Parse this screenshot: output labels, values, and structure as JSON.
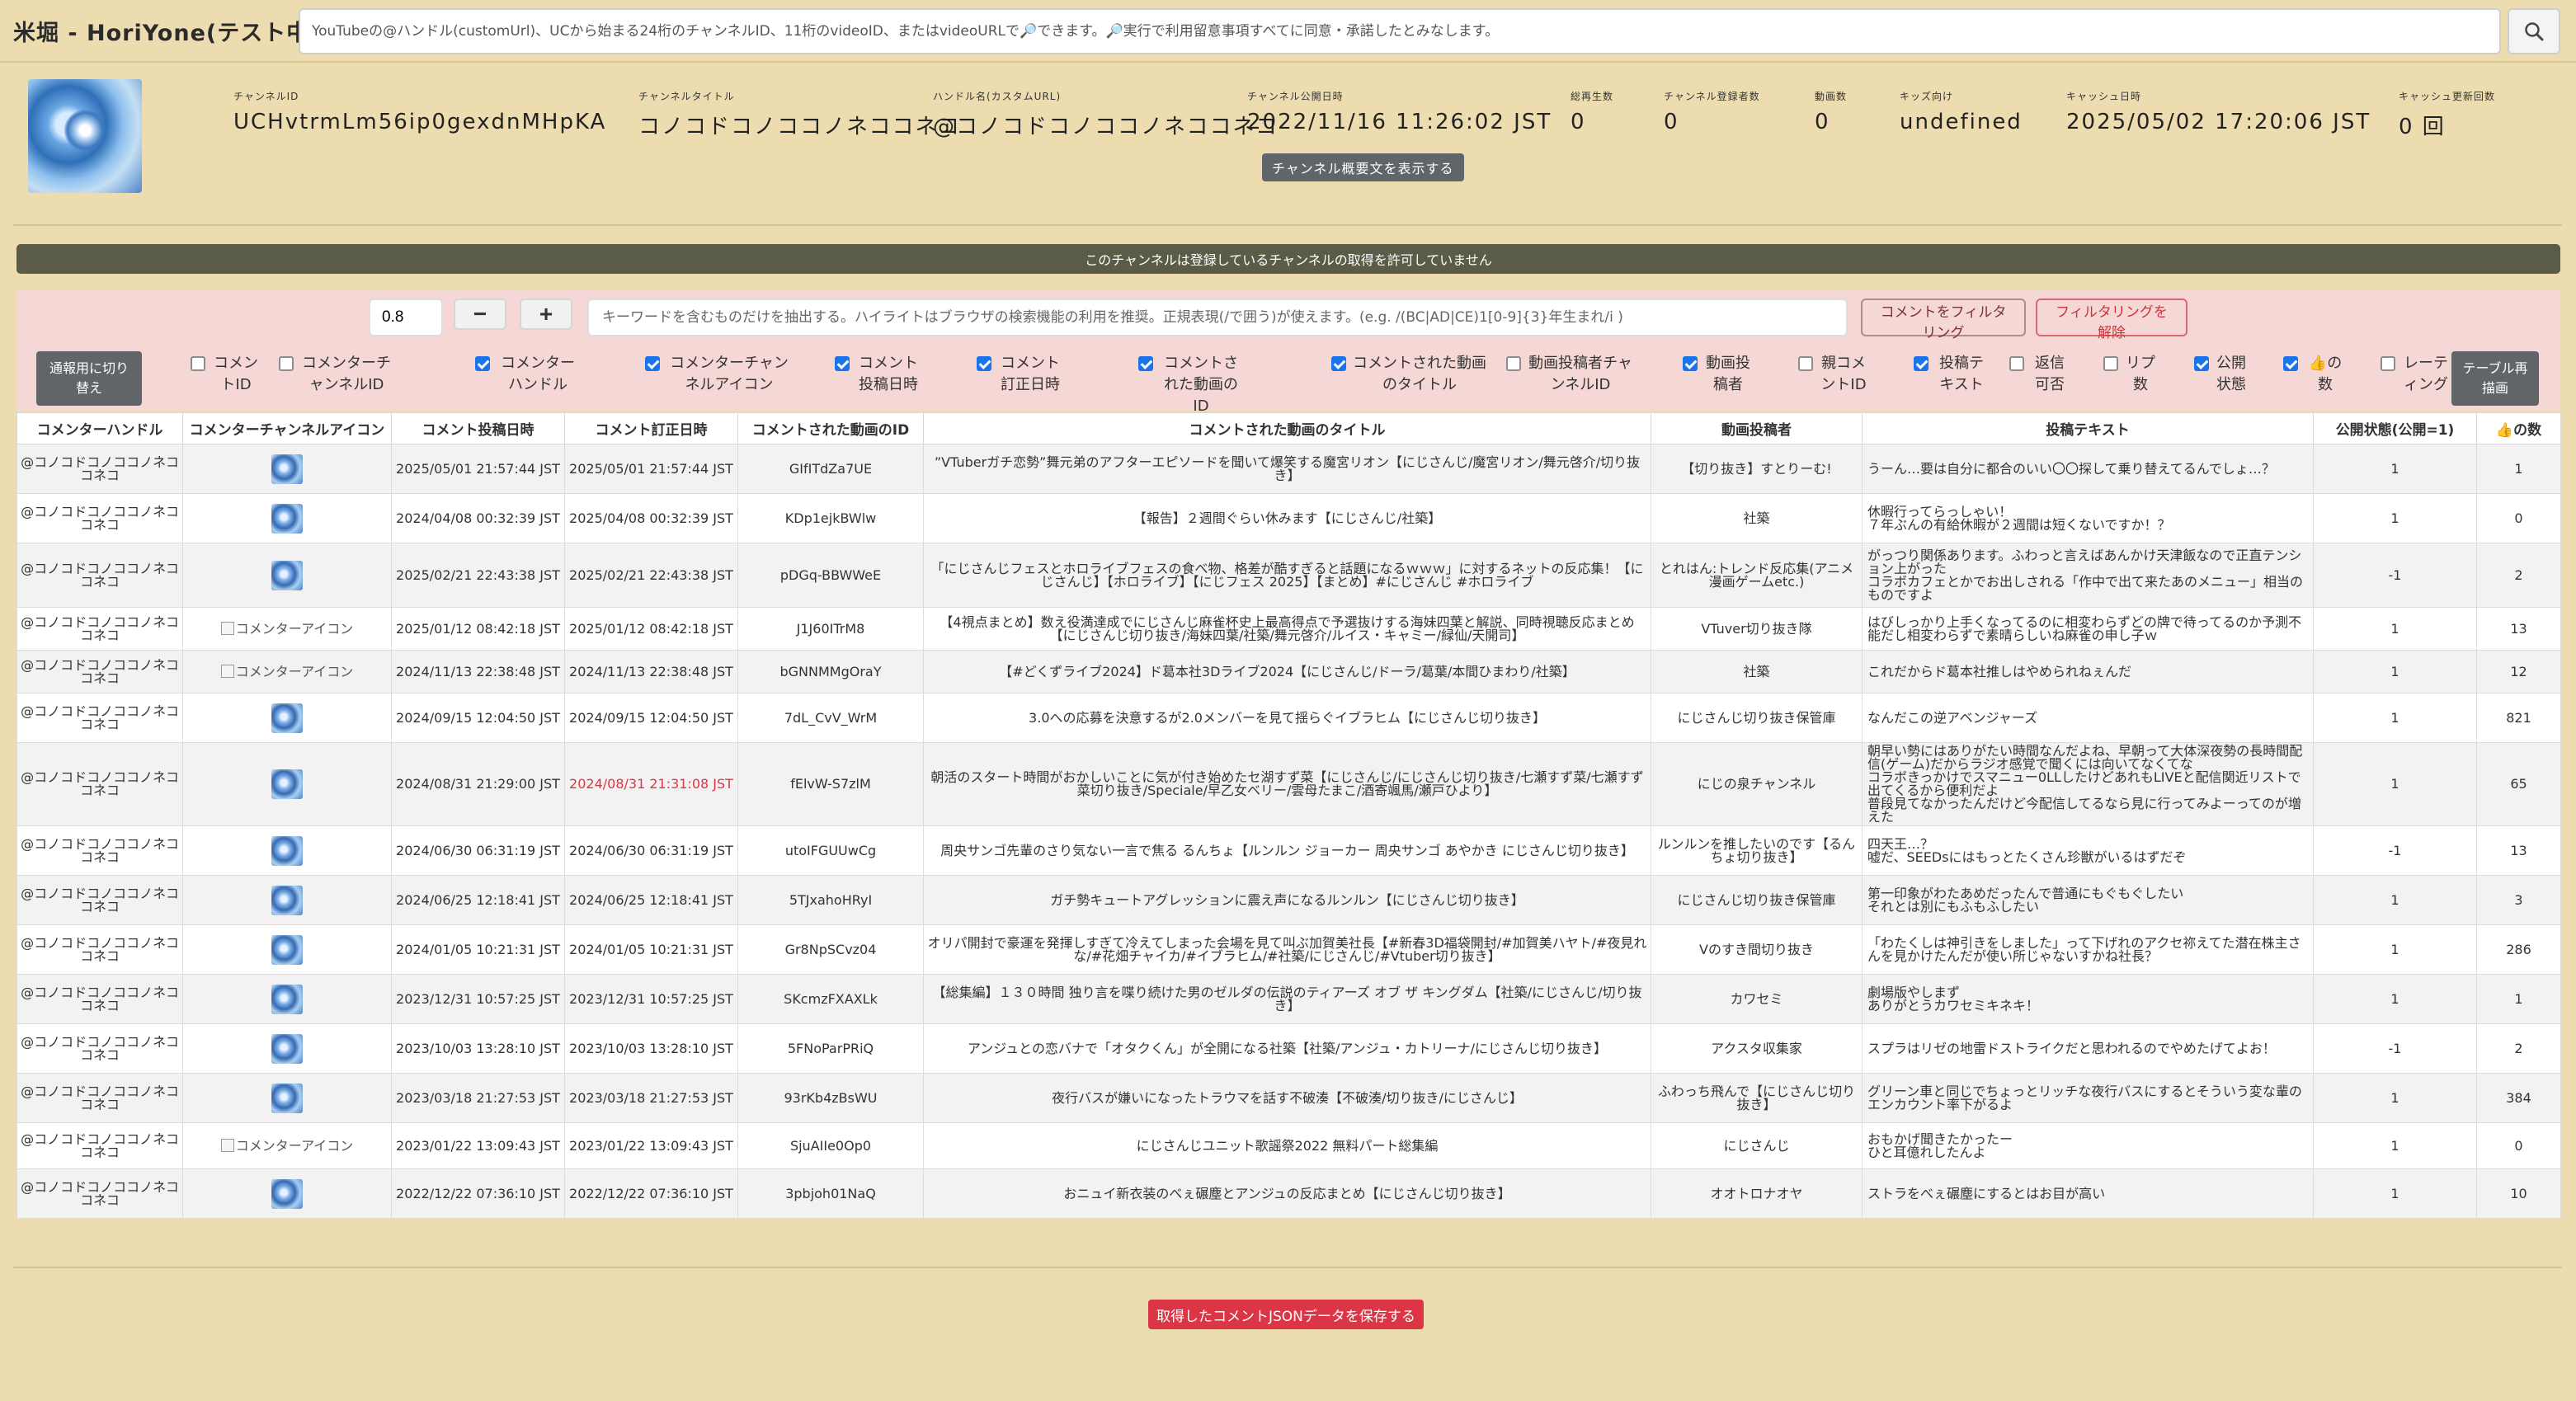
{
  "app": {
    "title": "米堀 - HoriYone(テスト中)",
    "search_placeholder": "YouTubeの@ハンドル(customUrl)、UCから始まる24桁のチャンネルID、11桁のvideoID、またはvideoURLで🔎できます。🔎実行で利用留意事項すべてに同意・承諾したとみなします。"
  },
  "channel": {
    "fields": [
      {
        "label": "チャンネルID",
        "value": "UCHvtrmLm56ip0gexdnMHpKA"
      },
      {
        "label": "チャンネルタイトル",
        "value": "コノコドコノココノネココネコ"
      },
      {
        "label": "ハンドル名(カスタムURL)",
        "value": "@コノコドコノココノネココネコ"
      },
      {
        "label": "チャンネル公開日時",
        "value": "2022/11/16 11:26:02 JST"
      },
      {
        "label": "総再生数",
        "value": "0"
      },
      {
        "label": "チャンネル登録者数",
        "value": "0"
      },
      {
        "label": "動画数",
        "value": "0"
      },
      {
        "label": "キッズ向け",
        "value": "undefined"
      },
      {
        "label": "キャッシュ日時",
        "value": "2025/05/02 17:20:06 JST"
      },
      {
        "label": "キャッシュ更新回数",
        "value": "0 回"
      }
    ],
    "description_button": "チャンネル概要文を表示する"
  },
  "notice": "このチャンネルは登録しているチャンネルの取得を許可していません",
  "filter": {
    "threshold": "0.8",
    "minus": "−",
    "plus": "+",
    "keyword_placeholder": "キーワードを含むものだけを抽出する。ハイライトはブラウザの検索機能の利用を推奨。正規表現(/で囲う)が使えます。(e.g. /(BC|AD|CE)1[0-9]{3}年生まれ/i )",
    "filter_button": "コメントをフィルタリング",
    "clear_button": "フィルタリングを解除",
    "toggle_mode_button": "通報用に切り替え",
    "redraw_button": "テーブル再描画",
    "columns": [
      {
        "label": "コメントID",
        "checked": false
      },
      {
        "label": "コメンターチャンネルID",
        "checked": false
      },
      {
        "label": "コメンターハンドル",
        "checked": true
      },
      {
        "label": "コメンターチャンネルアイコン",
        "checked": true
      },
      {
        "label": "コメント投稿日時",
        "checked": true
      },
      {
        "label": "コメント訂正日時",
        "checked": true
      },
      {
        "label": "コメントされた動画のID",
        "checked": true
      },
      {
        "label": "コメントされた動画のタイトル",
        "checked": true
      },
      {
        "label": "動画投稿者チャンネルID",
        "checked": false
      },
      {
        "label": "動画投稿者",
        "checked": true
      },
      {
        "label": "親コメントID",
        "checked": false
      },
      {
        "label": "投稿テキスト",
        "checked": true
      },
      {
        "label": "返信可否",
        "checked": false
      },
      {
        "label": "リプ数",
        "checked": false
      },
      {
        "label": "公開状態",
        "checked": true
      },
      {
        "label": "👍の数",
        "checked": true
      },
      {
        "label": "レーティング",
        "checked": false
      }
    ]
  },
  "table": {
    "headers": [
      "コメンターハンドル",
      "コメンターチャンネルアイコン",
      "コメント投稿日時",
      "コメント訂正日時",
      "コメントされた動画のID",
      "コメントされた動画のタイトル",
      "動画投稿者",
      "投稿テキスト",
      "公開状態(公開=1)",
      "👍の数"
    ],
    "icon_alt": "コメンターアイコン",
    "rows": [
      {
        "handle": "@コノコドコノココノネココネコ",
        "icon": "image",
        "posted": "2025/05/01 21:57:44 JST",
        "edited": "2025/05/01 21:57:44 JST",
        "edited_red": false,
        "video_id": "GIfITdZa7UE",
        "video_title": "”VTuberガチ恋勢”舞元弟のアフターエピソードを聞いて爆笑する魔宮リオン【にじさんじ/魔宮リオン/舞元啓介/切り抜き】",
        "uploader": "【切り抜き】すとりーむ!",
        "text": "うーん…要は自分に都合のいい〇〇探して乗り替えてるんでしょ…？",
        "public": "1",
        "likes": "1"
      },
      {
        "handle": "@コノコドコノココノネココネコ",
        "icon": "image",
        "posted": "2024/04/08 00:32:39 JST",
        "edited": "2025/04/08 00:32:39 JST",
        "edited_red": false,
        "video_id": "KDp1ejkBWlw",
        "video_title": "【報告】２週間ぐらい休みます【にじさんじ/社築】",
        "uploader": "社築",
        "text": "休暇行ってらっしゃい！\n７年ぶんの有給休暇が２週間は短くないですか！？",
        "public": "1",
        "likes": "0"
      },
      {
        "handle": "@コノコドコノココノネココネコ",
        "icon": "image",
        "posted": "2025/02/21 22:43:38 JST",
        "edited": "2025/02/21 22:43:38 JST",
        "edited_red": false,
        "video_id": "pDGq-BBWWeE",
        "video_title": "「にじさんじフェスとホロライブフェスの食べ物、格差が酷すぎると話題になるｗｗｗ」に対するネットの反応集！【にじさんじ】【ホロライブ】【にじフェス 2025】【まとめ】#にじさんじ #ホロライブ",
        "uploader": "とれはん:トレンド反応集(アニメ漫画ゲームetc.)",
        "text": "がっつり関係あります。ふわっと言えばあんかけ天津飯なので正直テンション上がった\nコラボカフェとかでお出しされる「作中で出て来たあのメニュー」相当のものですよ",
        "public": "-1",
        "likes": "2"
      },
      {
        "handle": "@コノコドコノココノネココネコ",
        "icon": "broken",
        "posted": "2025/01/12 08:42:18 JST",
        "edited": "2025/01/12 08:42:18 JST",
        "edited_red": false,
        "video_id": "J1J60ITrM8",
        "video_title": "【4視点まとめ】数え役満達成でにじさんじ麻雀杯史上最高得点で予選抜けする海妹四葉と解説、同時視聴反応まとめ【にじさんじ切り抜き/海妹四葉/社築/舞元啓介/ルイス・キャミー/緑仙/天開司】",
        "uploader": "VTuver切り抜き隊",
        "text": "はびしっかり上手くなってるのに相変わらずどの牌で待ってるのか予測不能だし相変わらずで素晴らしいね麻雀の申し子ｗ",
        "public": "1",
        "likes": "13"
      },
      {
        "handle": "@コノコドコノココノネココネコ",
        "icon": "broken",
        "posted": "2024/11/13 22:38:48 JST",
        "edited": "2024/11/13 22:38:48 JST",
        "edited_red": false,
        "video_id": "bGNNMMgOraY",
        "video_title": "【#どくずライブ2024】ド葛本社3Dライブ2024【にじさんじ/ドーラ/葛葉/本間ひまわり/社築】",
        "uploader": "社築",
        "text": "これだからド葛本社推しはやめられねぇんだ",
        "public": "1",
        "likes": "12"
      },
      {
        "handle": "@コノコドコノココノネココネコ",
        "icon": "image",
        "posted": "2024/09/15 12:04:50 JST",
        "edited": "2024/09/15 12:04:50 JST",
        "edited_red": false,
        "video_id": "7dL_CvV_WrM",
        "video_title": "3.0への応募を決意するが2.0メンバーを見て揺らぐイブラヒム【にじさんじ切り抜き】",
        "uploader": "にじさんじ切り抜き保管庫",
        "text": "なんだこの逆アベンジャーズ",
        "public": "1",
        "likes": "821"
      },
      {
        "handle": "@コノコドコノココノネココネコ",
        "icon": "image",
        "posted": "2024/08/31 21:29:00 JST",
        "edited": "2024/08/31 21:31:08 JST",
        "edited_red": true,
        "video_id": "fElvW-S7zlM",
        "video_title": "朝活のスタート時間がおかしいことに気が付き始めたセ湖すず菜【にじさんじ/にじさんじ切り抜き/七瀬すず菜/七瀬すず菜切り抜き/Speciale/早乙女ベリー/雲母たまこ/酒寄颯馬/瀬戸ひより】",
        "uploader": "にじの泉チャンネル",
        "text": "朝早い勢にはありがたい時間なんだよね、早朝って大体深夜勢の長時間配信(ゲーム)だからラジオ感覚で聞くには向いてなくてな\nコラボきっかけでスマニュー0LLしたけどあれもLIVEと配信関近リストで出てくるから便利だよ\n普段見てなかったんだけど今配信してるなら見に行ってみよーってのが増えた",
        "public": "1",
        "likes": "65"
      },
      {
        "handle": "@コノコドコノココノネココネコ",
        "icon": "image",
        "posted": "2024/06/30 06:31:19 JST",
        "edited": "2024/06/30 06:31:19 JST",
        "edited_red": false,
        "video_id": "utoIFGUUwCg",
        "video_title": "周央サンゴ先輩のさり気ない一言で焦る るんちょ【ルンルン ジョーカー 周央サンゴ あやかき にじさんじ切り抜き】",
        "uploader": "ルンルンを推したいのです【るんちょ切り抜き】",
        "text": "四天王…？\n嘘だ、SEEDsにはもっとたくさん珍獣がいるはずだぞ",
        "public": "-1",
        "likes": "13"
      },
      {
        "handle": "@コノコドコノココノネココネコ",
        "icon": "image",
        "posted": "2024/06/25 12:18:41 JST",
        "edited": "2024/06/25 12:18:41 JST",
        "edited_red": false,
        "video_id": "5TJxahoHRyI",
        "video_title": "ガチ勢キュートアグレッションに震え声になるルンルン【にじさんじ切り抜き】",
        "uploader": "にじさんじ切り抜き保管庫",
        "text": "第一印象がわたあめだったんで普通にもぐもぐしたい\nそれとは別にもふもふしたい",
        "public": "1",
        "likes": "3"
      },
      {
        "handle": "@コノコドコノココノネココネコ",
        "icon": "image",
        "posted": "2024/01/05 10:21:31 JST",
        "edited": "2024/01/05 10:21:31 JST",
        "edited_red": false,
        "video_id": "Gr8NpSCvz04",
        "video_title": "オリパ開封で豪運を発揮しすぎて冷えてしまった会場を見て叫ぶ加賀美社長【#新春3D福袋開封/#加賀美ハヤト/#夜見れな/#花畑チャイカ/#イブラヒム/#社築/にじさんじ/#Vtuber切り抜き】",
        "uploader": "Vのすき間切り抜き",
        "text": "「わたくしは神引きをしました」って下げれのアクセ祢えてた潜在株主さんを見かけたんだが使い所じゃないすかね社長？",
        "public": "1",
        "likes": "286"
      },
      {
        "handle": "@コノコドコノココノネココネコ",
        "icon": "image",
        "posted": "2023/12/31 10:57:25 JST",
        "edited": "2023/12/31 10:57:25 JST",
        "edited_red": false,
        "video_id": "SKcmzFXAXLk",
        "video_title": "【総集編】１３０時間 独り言を喋り続けた男のゼルダの伝説のティアーズ オブ ザ キングダム【社築/にじさんじ/切り抜き】",
        "uploader": "カワセミ",
        "text": "劇場版やしまず\nありがとうカワセミキネキ！",
        "public": "1",
        "likes": "1"
      },
      {
        "handle": "@コノコドコノココノネココネコ",
        "icon": "image",
        "posted": "2023/10/03 13:28:10 JST",
        "edited": "2023/10/03 13:28:10 JST",
        "edited_red": false,
        "video_id": "5FNoParPRiQ",
        "video_title": "アンジュとの恋バナで「オタクくん」が全開になる社築【社築/アンジュ・カトリーナ/にじさんじ切り抜き】",
        "uploader": "アクスタ収集家",
        "text": "スプラはリゼの地雷ドストライクだと思われるのでやめたげてよお！",
        "public": "-1",
        "likes": "2"
      },
      {
        "handle": "@コノコドコノココノネココネコ",
        "icon": "image",
        "posted": "2023/03/18 21:27:53 JST",
        "edited": "2023/03/18 21:27:53 JST",
        "edited_red": false,
        "video_id": "93rKb4zBsWU",
        "video_title": "夜行バスが嫌いになったトラウマを話す不破湊【不破湊/切り抜き/にじさんじ】",
        "uploader": "ふわっち飛んで【にじさんじ切り抜き】",
        "text": "グリーン車と同じでちょっとリッチな夜行バスにするとそういう変な輩のエンカウント率下がるよ",
        "public": "1",
        "likes": "384"
      },
      {
        "handle": "@コノコドコノココノネココネコ",
        "icon": "broken",
        "posted": "2023/01/22 13:09:43 JST",
        "edited": "2023/01/22 13:09:43 JST",
        "edited_red": false,
        "video_id": "SjuAIIe0Op0",
        "video_title": "にじさんじユニット歌謡祭2022 無料パート総集編",
        "uploader": "にじさんじ",
        "text": "おもかげ聞きたかったー\nひと耳億れしたんよ",
        "public": "1",
        "likes": "0"
      },
      {
        "handle": "@コノコドコノココノネココネコ",
        "icon": "image",
        "posted": "2022/12/22 07:36:10 JST",
        "edited": "2022/12/22 07:36:10 JST",
        "edited_red": false,
        "video_id": "3pbjoh01NaQ",
        "video_title": "おニュイ新衣装のべぇ碾塵とアンジュの反応まとめ【にじさんじ切り抜き】",
        "uploader": "オオトロナオヤ",
        "text": "ストラをべぇ碾塵にするとはお目が高い",
        "public": "1",
        "likes": "10"
      }
    ]
  },
  "save_button": "取得したコメントJSONデータを保存する"
}
